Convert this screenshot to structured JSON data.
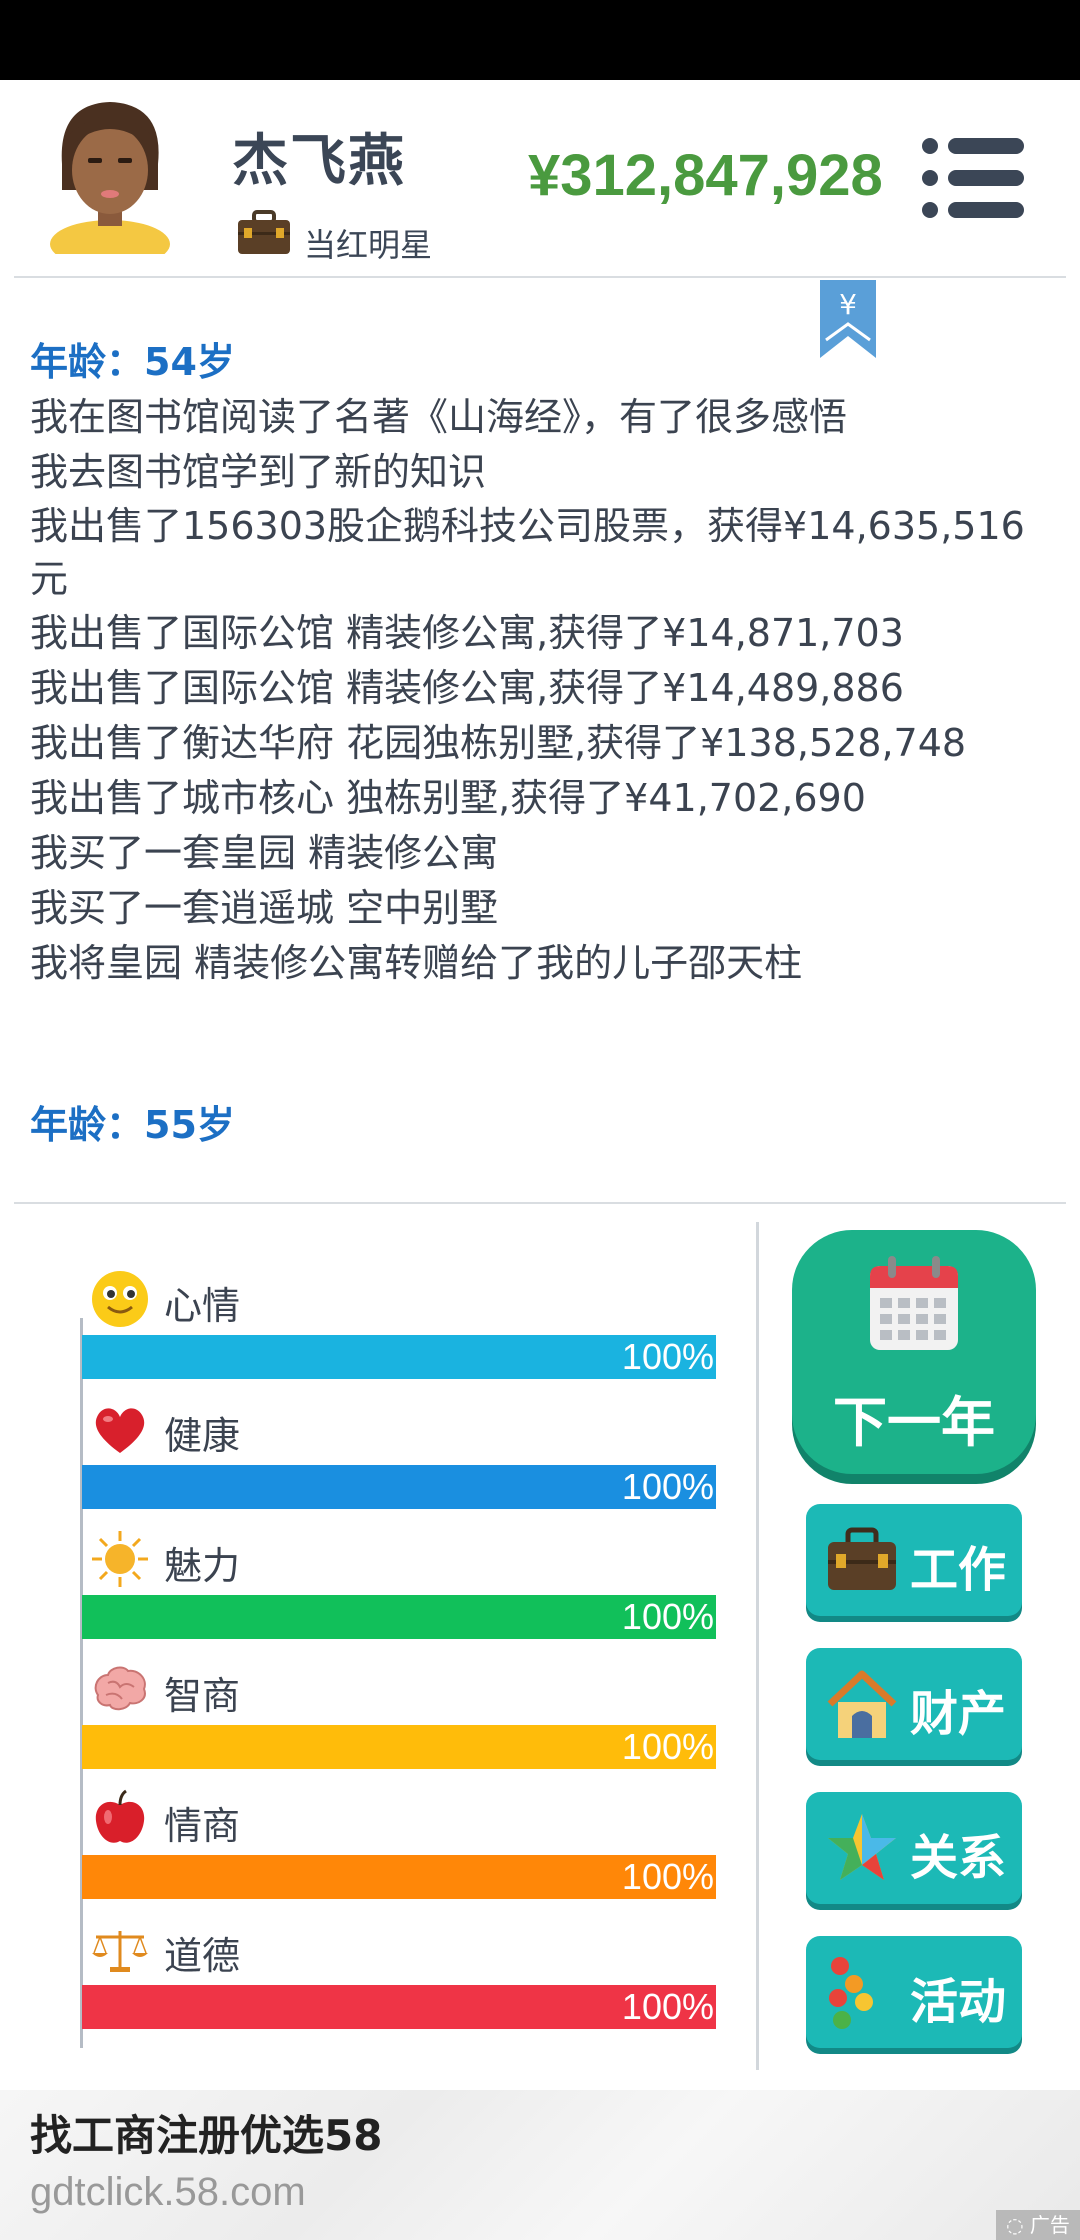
{
  "header": {
    "name": "杰飞燕",
    "job": "当红明星",
    "money": "¥312,847,928"
  },
  "log": {
    "age_1": "年龄：54岁",
    "entries": [
      "我在图书馆阅读了名著《山海经》，有了很多感悟",
      "我去图书馆学到了新的知识",
      "我出售了156303股企鹅科技公司股票，获得¥14,635,516元",
      "我出售了国际公馆 精装修公寓,获得了¥14,871,703",
      "我出售了国际公馆 精装修公寓,获得了¥14,489,886",
      "我出售了衡达华府 花园独栋别墅,获得了¥138,528,748",
      "我出售了城市核心 独栋别墅,获得了¥41,702,690",
      "我买了一套皇园 精装修公寓",
      "我买了一套逍遥城 空中别墅",
      "我将皇园 精装修公寓转赠给了我的儿子邵天柱"
    ],
    "age_2": "年龄：55岁"
  },
  "stats": [
    {
      "label": "心情",
      "value": 100,
      "text": "100%",
      "color": "#1ab3e0",
      "icon": "smiley-icon"
    },
    {
      "label": "健康",
      "value": 100,
      "text": "100%",
      "color": "#1a8fe0",
      "icon": "heart-icon"
    },
    {
      "label": "魅力",
      "value": 100,
      "text": "100%",
      "color": "#11c05a",
      "icon": "sun-icon"
    },
    {
      "label": "智商",
      "value": 100,
      "text": "100%",
      "color": "#ffbc0a",
      "icon": "brain-icon"
    },
    {
      "label": "情商",
      "value": 100,
      "text": "100%",
      "color": "#ff8708",
      "icon": "apple-icon"
    },
    {
      "label": "道德",
      "value": 100,
      "text": "100%",
      "color": "#ef3446",
      "icon": "scales-icon"
    }
  ],
  "actions": {
    "next_year": "下一年",
    "work": "工作",
    "property": "财产",
    "relation": "关系",
    "activity": "活动"
  },
  "ad": {
    "title": "找工商注册优选58",
    "url": "gdtclick.58.com",
    "tag": "广告"
  },
  "colors": {
    "money": "#4a9a3f",
    "age": "#1c6fc4",
    "next_button": "#1cb28a",
    "side_button": "#1cb9b6"
  }
}
